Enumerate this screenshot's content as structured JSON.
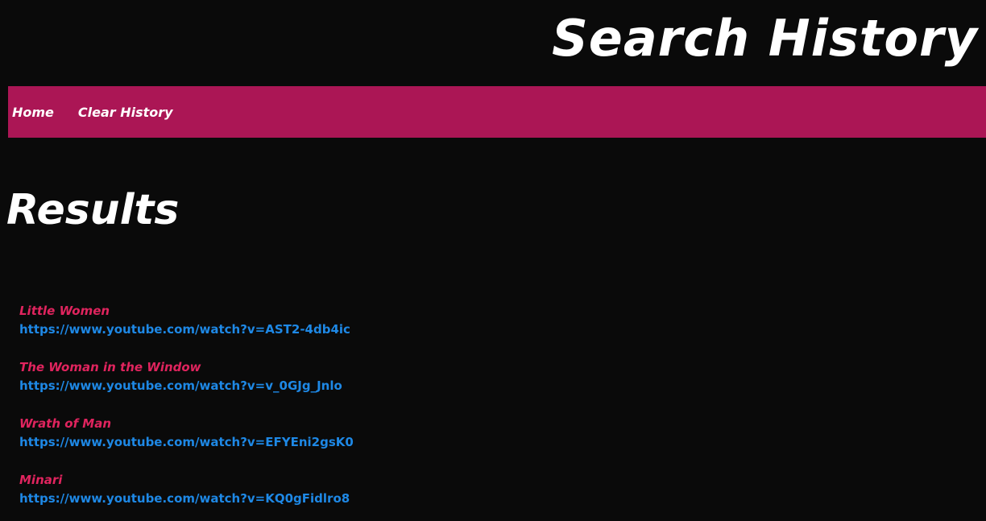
{
  "header": {
    "title": "Search History"
  },
  "nav": {
    "items": [
      {
        "label": "Home"
      },
      {
        "label": "Clear History"
      }
    ]
  },
  "main": {
    "heading": "Results",
    "results": [
      {
        "title": "Little Women",
        "url": "https://www.youtube.com/watch?v=AST2-4db4ic"
      },
      {
        "title": "The Woman in the Window",
        "url": "https://www.youtube.com/watch?v=v_0GJg_Jnlo"
      },
      {
        "title": "Wrath of Man",
        "url": "https://www.youtube.com/watch?v=EFYEni2gsK0"
      },
      {
        "title": "Minari",
        "url": "https://www.youtube.com/watch?v=KQ0gFidlro8"
      }
    ]
  },
  "colors": {
    "background": "#0a0a0a",
    "navbar": "#ab1655",
    "result_title": "#e0245e",
    "result_link": "#1e88e5",
    "text": "#ffffff"
  }
}
